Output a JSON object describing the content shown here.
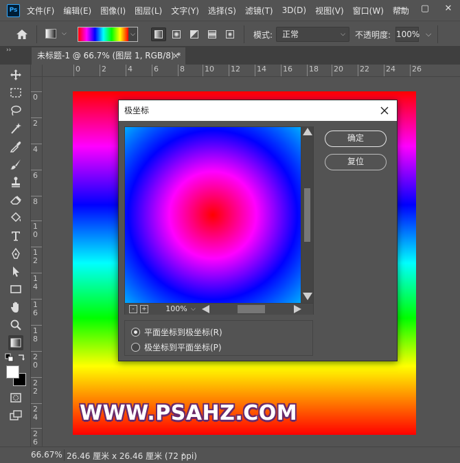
{
  "app": {
    "logo_text": "Ps"
  },
  "menu": [
    "文件(F)",
    "编辑(E)",
    "图像(I)",
    "图层(L)",
    "文字(Y)",
    "选择(S)",
    "滤镜(T)",
    "3D(D)",
    "视图(V)",
    "窗口(W)",
    "帮助"
  ],
  "window_controls": {
    "minimize": "—",
    "maximize": "▢",
    "close": "✕"
  },
  "options_bar": {
    "mode_label": "模式:",
    "mode_value": "正常",
    "opacity_label": "不透明度:",
    "opacity_value": "100%",
    "gradient_colors": [
      "#ff0000",
      "#ff00ff",
      "#0000ff",
      "#00ffff",
      "#00ff00",
      "#ffff00",
      "#ff0000"
    ]
  },
  "tab": {
    "collapse": "››",
    "title": "未标题-1 @ 66.7% (图层 1, RGB/8) *",
    "close": "×"
  },
  "ruler_h": [
    "0",
    "2",
    "4",
    "6",
    "8",
    "10",
    "12",
    "14",
    "16",
    "18",
    "20",
    "22",
    "24",
    "26"
  ],
  "ruler_v": [
    "0",
    "2",
    "4",
    "6",
    "8",
    "10",
    "12",
    "14",
    "16",
    "18",
    "20",
    "22",
    "24",
    "26"
  ],
  "canvas": {
    "watermark": "WWW.PSAHZ.COM"
  },
  "status": {
    "zoom": "66.67%",
    "doc_info": "26.46 厘米 x 26.46 厘米 (72 ppi)",
    "arrow": "›"
  },
  "dialog": {
    "title": "极坐标",
    "close": "✕",
    "ok": "确定",
    "reset": "复位",
    "zoom_level": "100%",
    "zoom_minus": "-",
    "zoom_plus": "+",
    "options": [
      {
        "label": "平面坐标到极坐标(R)",
        "checked": true
      },
      {
        "label": "极坐标到平面坐标(P)",
        "checked": false
      }
    ]
  }
}
